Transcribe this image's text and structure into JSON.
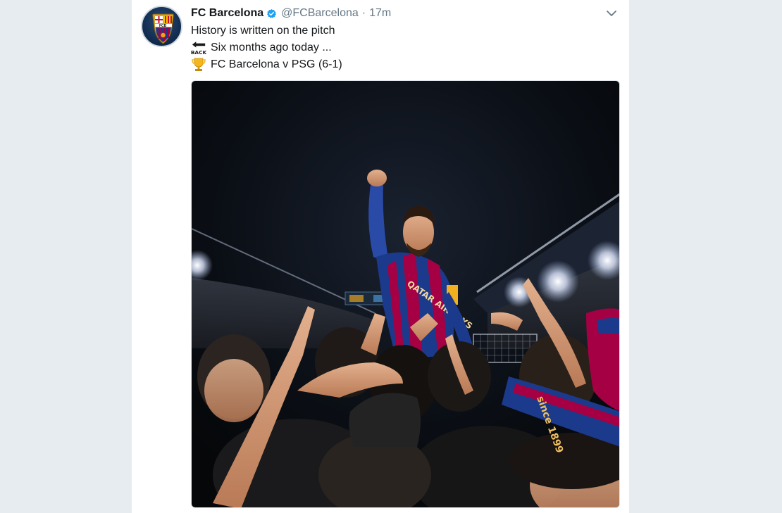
{
  "tweet": {
    "author_name": "FC Barcelona",
    "handle": "@FCBarcelona",
    "separator": "·",
    "time": "17m",
    "lines": [
      "History is written on the pitch",
      "Six months ago today ...",
      "FC Barcelona v PSG (6-1)"
    ],
    "back_emoji_text": "BACK",
    "avatar_badge_text": "FCB",
    "media_shirt_text": "QATAR AIRWAYS",
    "media_scarf_text": "since 1899"
  },
  "icons": {
    "verified": "verified-badge-icon",
    "caret": "chevron-down-icon",
    "back_arrow": "back-arrow-emoji-icon",
    "trophy": "trophy-emoji-icon"
  },
  "colors": {
    "page_bg": "#e6ecf0",
    "card_bg": "#ffffff",
    "verified_blue": "#1da1f2",
    "secondary_text": "#657786",
    "barca_blue": "#1c3a8c",
    "barca_red": "#a50044"
  }
}
